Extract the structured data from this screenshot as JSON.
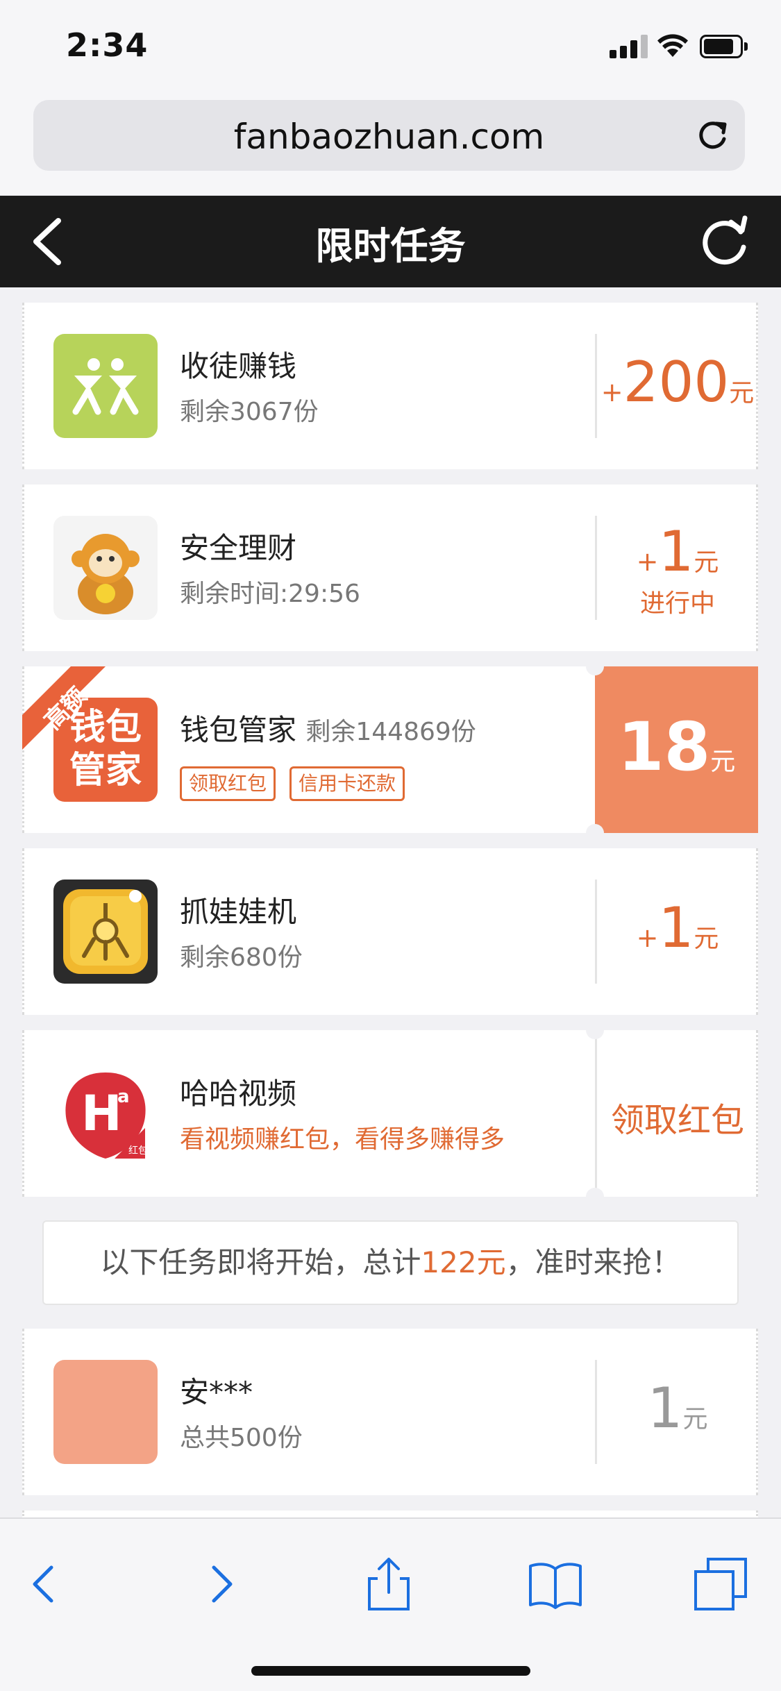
{
  "status_bar": {
    "time": "2:34"
  },
  "browser": {
    "url": "fanbaozhuan.com"
  },
  "header": {
    "title": "限时任务"
  },
  "tasks": [
    {
      "name": "收徒赚钱",
      "sub": "剩余3067份",
      "reward_plus": "+",
      "reward_amount": "200",
      "reward_unit": "元",
      "icon": "people-icon",
      "icon_color": "#b7d35a"
    },
    {
      "name": "安全理财",
      "sub": "剩余时间:29:56",
      "reward_plus": "+",
      "reward_amount": "1",
      "reward_unit": "元",
      "status": "进行中",
      "icon": "monkey-icon"
    },
    {
      "name": "钱包管家",
      "remaining": "剩余144869份",
      "tags": [
        "领取红包",
        "信用卡还款"
      ],
      "reward_amount": "18",
      "reward_unit": "元",
      "badge": "高额",
      "icon_text": "钱包\n管家",
      "icon": "wallet-manager-icon",
      "highlight_color": "#ef8a61"
    },
    {
      "name": "抓娃娃机",
      "sub": "剩余680份",
      "reward_plus": "+",
      "reward_amount": "1",
      "reward_unit": "元",
      "icon": "claw-machine-icon"
    },
    {
      "name": "哈哈视频",
      "sub": "看视频赚红包，看得多赚得多",
      "action": "领取红包",
      "icon": "haha-video-icon",
      "icon_text": "H",
      "icon_sup": "a",
      "icon_label": "红包"
    }
  ],
  "notice": {
    "prefix": "以下任务即将开始，总计",
    "amount": "122元",
    "suffix": "，准时来抢！"
  },
  "upcoming": [
    {
      "name": "安***",
      "sub": "总共500份",
      "reward_amount": "1",
      "reward_unit": "元",
      "icon_color": "#f3a386"
    }
  ],
  "accent_color": "#e06a33"
}
